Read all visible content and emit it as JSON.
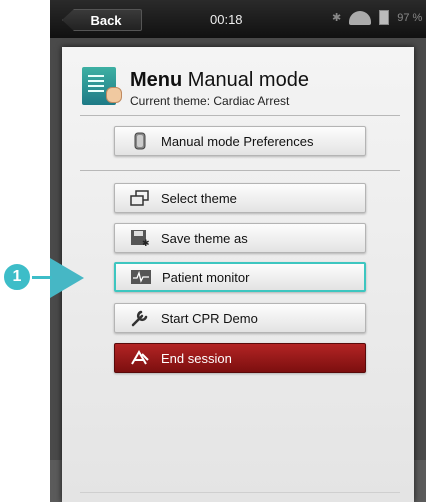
{
  "status_bar": {
    "back_label": "Back",
    "time": "00:18",
    "battery": "97 %"
  },
  "header": {
    "title_bold": "Menu",
    "title_rest": " Manual mode",
    "subtitle": "Current theme: Cardiac Arrest"
  },
  "buttons": [
    {
      "label": "Manual mode Preferences",
      "icon": "phone-icon"
    },
    {
      "label": "Select theme",
      "icon": "windows-icon"
    },
    {
      "label": "Save theme as",
      "icon": "save-icon"
    },
    {
      "label": "Patient monitor",
      "icon": "monitor-icon"
    },
    {
      "label": "Start CPR Demo",
      "icon": "wrench-icon"
    },
    {
      "label": "End session",
      "icon": "end-session-icon"
    }
  ],
  "callout": {
    "number": "1",
    "color": "#3dbdc8"
  },
  "colors": {
    "accent": "#3dc6c0",
    "danger": "#9a1818"
  }
}
